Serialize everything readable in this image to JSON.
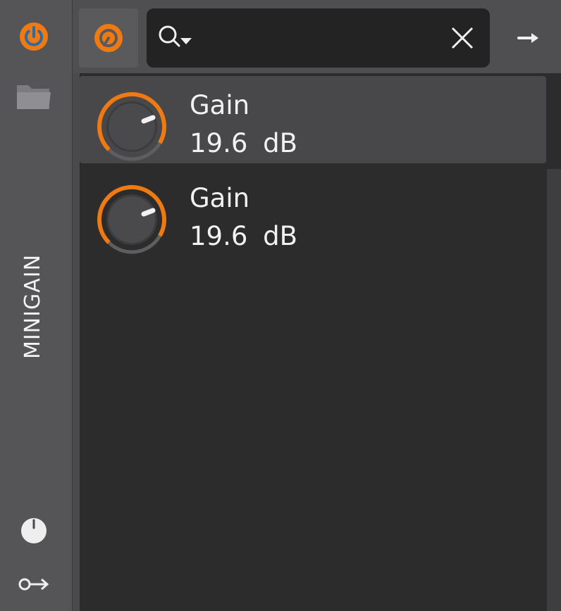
{
  "app": {
    "sidebar_title": "MINIGAIN"
  },
  "search": {
    "value": "",
    "placeholder": ""
  },
  "icons": {
    "power": "power-icon",
    "folder": "folder-icon",
    "plugin": "plugin-logo-icon",
    "search": "search-dropdown-icon",
    "clear": "close-icon",
    "arrow": "arrow-right-icon",
    "knob": "knob-icon",
    "key_arrow": "key-arrow-icon"
  },
  "colors": {
    "accent": "#f07a12",
    "sidebar": "#555558",
    "panel": "#2c2c2d"
  },
  "parameters": [
    {
      "name": "Gain",
      "value": "19.6 dB",
      "selected": true
    },
    {
      "name": "Gain",
      "value": "19.6 dB",
      "selected": false
    }
  ]
}
